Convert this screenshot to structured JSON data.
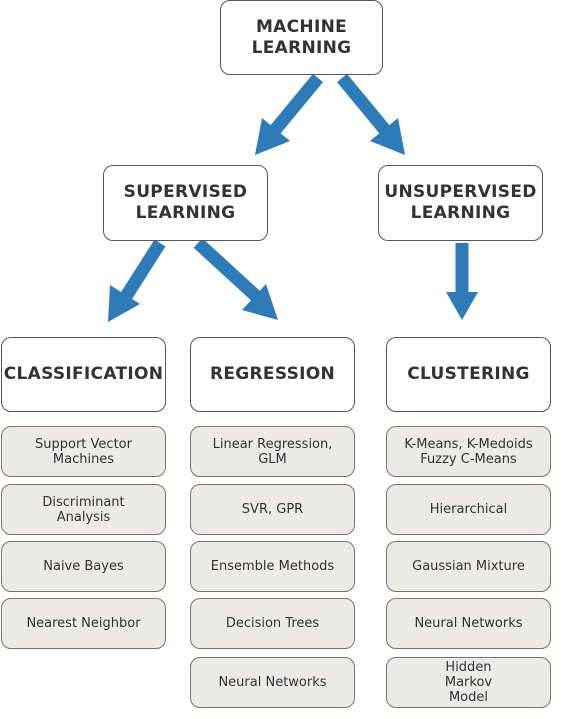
{
  "root": "MACHINE LEARNING",
  "level1": [
    "SUPERVISED LEARNING",
    "UNSUPERVISED LEARNING"
  ],
  "categories": [
    {
      "title": "CLASSIFICATION",
      "items": [
        "Support Vector Machines",
        "Discriminant Analysis",
        "Naive Bayes",
        "Nearest Neighbor"
      ]
    },
    {
      "title": "REGRESSION",
      "items": [
        "Linear Regression, GLM",
        "SVR, GPR",
        "Ensemble Methods",
        "Decision Trees",
        "Neural Networks"
      ]
    },
    {
      "title": "CLUSTERING",
      "items": [
        "K-Means, K-Medoids Fuzzy C-Means",
        "Hierarchical",
        "Gaussian Mixture",
        "Neural Networks",
        "Hidden Markov Model"
      ]
    }
  ],
  "colors": {
    "arrow": "#2e7bb8",
    "leaf_fill": "#ebeae5",
    "border": "#5a5552"
  }
}
